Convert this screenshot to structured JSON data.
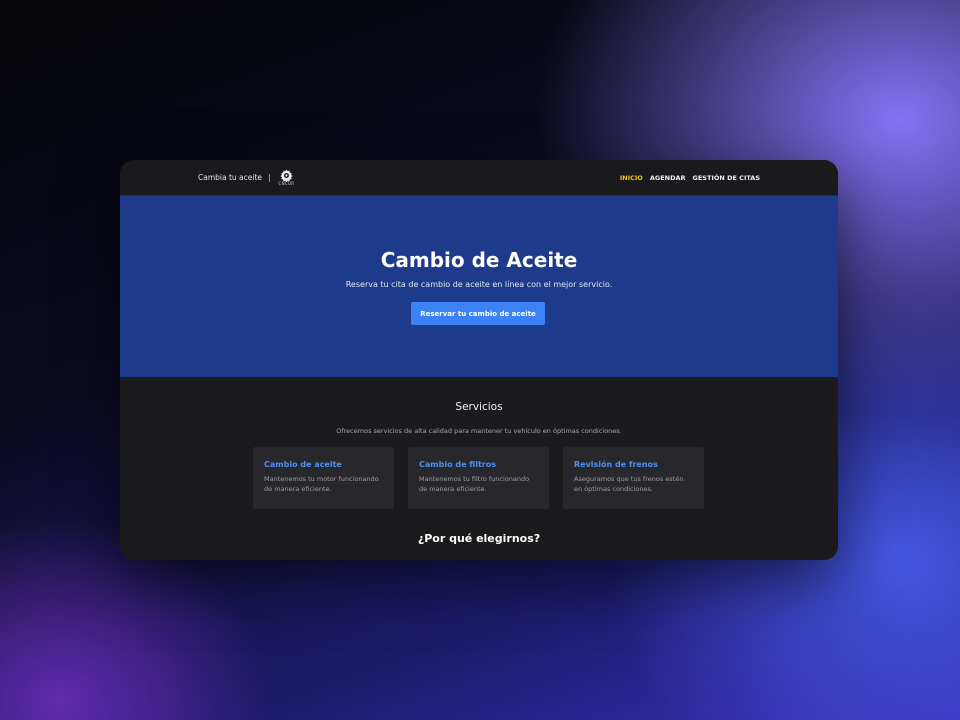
{
  "navbar": {
    "brand_text": "Cambia tu aceite",
    "separator": "|",
    "logo_text": "CNCUR",
    "logo_icon": "gear-icon",
    "links": [
      {
        "label": "INICIO",
        "active": true
      },
      {
        "label": "AGENDAR",
        "active": false
      },
      {
        "label": "GESTIÓN DE CITAS",
        "active": false
      }
    ],
    "active_color": "#f2c414"
  },
  "hero": {
    "title": "Cambio de Aceite",
    "subtitle": "Reserva tu cita de cambio de aceite en línea con el mejor servicio.",
    "cta_label": "Reservar tu cambio de aceite",
    "background": "#1e3a8a",
    "cta_color": "#3b82f6"
  },
  "services": {
    "title": "Servicios",
    "subtitle": "Ofrecemos servicios de alta calidad para mantener tu vehículo en óptimas condiciones.",
    "cards": [
      {
        "title": "Cambio de aceite",
        "line1": "Mantenemos tu motor funcionando",
        "line2": "de manera eficiente."
      },
      {
        "title": "Cambio de filtros",
        "line1": "Mantenemos tu filtro funcionando",
        "line2": "de manera eficiente."
      },
      {
        "title": "Revisión de frenos",
        "line1": "Aseguramos que tus frenos estén",
        "line2": "en óptimas condiciones."
      }
    ]
  },
  "why": {
    "title": "¿Por qué elegirnos?"
  }
}
